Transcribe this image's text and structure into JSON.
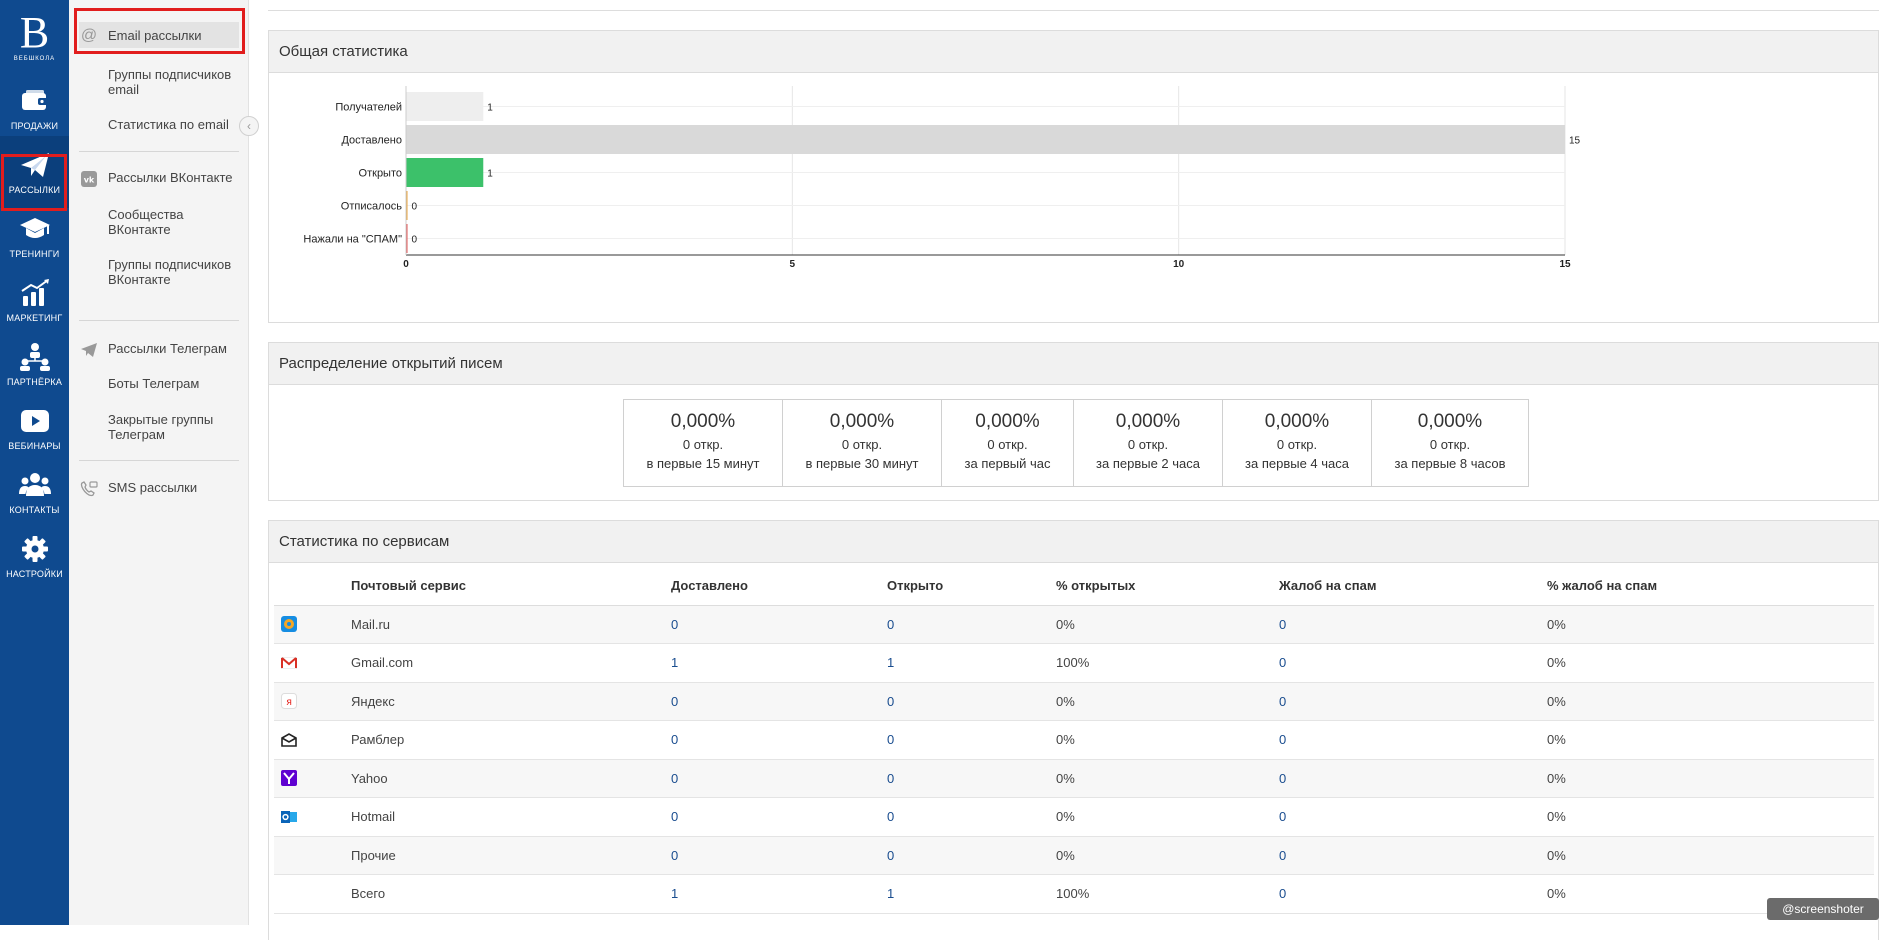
{
  "rail": {
    "logo_letter": "B",
    "logo_text": "ВЕБШКОЛА",
    "items": [
      {
        "label": "ПРОДАЖИ",
        "icon": "wallet-icon"
      },
      {
        "label": "РАССЫЛКИ",
        "icon": "paper-plane-icon",
        "active": true
      },
      {
        "label": "ТРЕНИНГИ",
        "icon": "graduation-cap-icon"
      },
      {
        "label": "МАРКЕТИНГ",
        "icon": "chart-growth-icon"
      },
      {
        "label": "ПАРТНЁРКА",
        "icon": "partners-icon"
      },
      {
        "label": "ВЕБИНАРЫ",
        "icon": "play-icon"
      },
      {
        "label": "КОНТАКТЫ",
        "icon": "users-icon"
      },
      {
        "label": "НАСТРОЙКИ",
        "icon": "gear-icon"
      }
    ]
  },
  "submenu": {
    "email_mailings": "Email рассылки",
    "email_groups": "Группы подписчиков email",
    "email_stats": "Статистика по email",
    "vk_mailings": "Рассылки ВКонтакте",
    "vk_communities": "Сообщества ВКонтакте",
    "vk_groups": "Группы подписчиков ВКонтакте",
    "tg_mailings": "Рассылки Телеграм",
    "tg_bots": "Боты Телеграм",
    "tg_closed_groups": "Закрытые группы Телеграм",
    "sms_mailings": "SMS рассылки"
  },
  "overall": {
    "title": "Общая статистика"
  },
  "chart_data": {
    "type": "bar",
    "orientation": "horizontal",
    "title": "",
    "categories": [
      "Получателей",
      "Доставлено",
      "Открыто",
      "Отписалось",
      "Нажали на \"СПАМ\""
    ],
    "values": [
      1,
      15,
      1,
      0,
      0
    ],
    "value_labels": [
      "1",
      "15",
      "1",
      "0",
      "0"
    ],
    "colors": [
      "#eeeeee",
      "#d9d9d9",
      "#3cc16a",
      "#e8a33d",
      "#e05555"
    ],
    "xlim": [
      0,
      15
    ],
    "xticks": [
      0,
      5,
      10,
      15
    ],
    "xtick_labels": [
      "0",
      "5",
      "10",
      "15"
    ],
    "grid": true
  },
  "distribution": {
    "title": "Распределение открытий писем",
    "cells": [
      {
        "pct": "0,000%",
        "count": "0 откр.",
        "period": "в первые 15 минут"
      },
      {
        "pct": "0,000%",
        "count": "0 откр.",
        "period": "в первые 30 минут"
      },
      {
        "pct": "0,000%",
        "count": "0 откр.",
        "period": "за первый час"
      },
      {
        "pct": "0,000%",
        "count": "0 откр.",
        "period": "за первые 2 часа"
      },
      {
        "pct": "0,000%",
        "count": "0 откр.",
        "period": "за первые 4 часа"
      },
      {
        "pct": "0,000%",
        "count": "0 откр.",
        "period": "за первые 8 часов"
      }
    ]
  },
  "services": {
    "title": "Статистика по сервисам",
    "columns": [
      "Почтовый сервис",
      "Доставлено",
      "Открыто",
      "% открытых",
      "Жалоб на спам",
      "% жалоб на спам"
    ],
    "rows": [
      {
        "icon": "mailru-icon",
        "name": "Mail.ru",
        "delivered": "0",
        "opened": "0",
        "open_pct": "0%",
        "spam": "0",
        "spam_pct": "0%"
      },
      {
        "icon": "gmail-icon",
        "name": "Gmail.com",
        "delivered": "1",
        "opened": "1",
        "open_pct": "100%",
        "spam": "0",
        "spam_pct": "0%"
      },
      {
        "icon": "yandex-icon",
        "name": "Яндекс",
        "delivered": "0",
        "opened": "0",
        "open_pct": "0%",
        "spam": "0",
        "spam_pct": "0%"
      },
      {
        "icon": "rambler-icon",
        "name": "Рамблер",
        "delivered": "0",
        "opened": "0",
        "open_pct": "0%",
        "spam": "0",
        "spam_pct": "0%"
      },
      {
        "icon": "yahoo-icon",
        "name": "Yahoo",
        "delivered": "0",
        "opened": "0",
        "open_pct": "0%",
        "spam": "0",
        "spam_pct": "0%"
      },
      {
        "icon": "hotmail-icon",
        "name": "Hotmail",
        "delivered": "0",
        "opened": "0",
        "open_pct": "0%",
        "spam": "0",
        "spam_pct": "0%"
      },
      {
        "icon": "",
        "name": "Прочие",
        "delivered": "0",
        "opened": "0",
        "open_pct": "0%",
        "spam": "0",
        "spam_pct": "0%"
      },
      {
        "icon": "",
        "name": "Всего",
        "delivered": "1",
        "opened": "1",
        "open_pct": "100%",
        "spam": "0",
        "spam_pct": "0%"
      }
    ]
  },
  "watermark": "@screenshoter"
}
